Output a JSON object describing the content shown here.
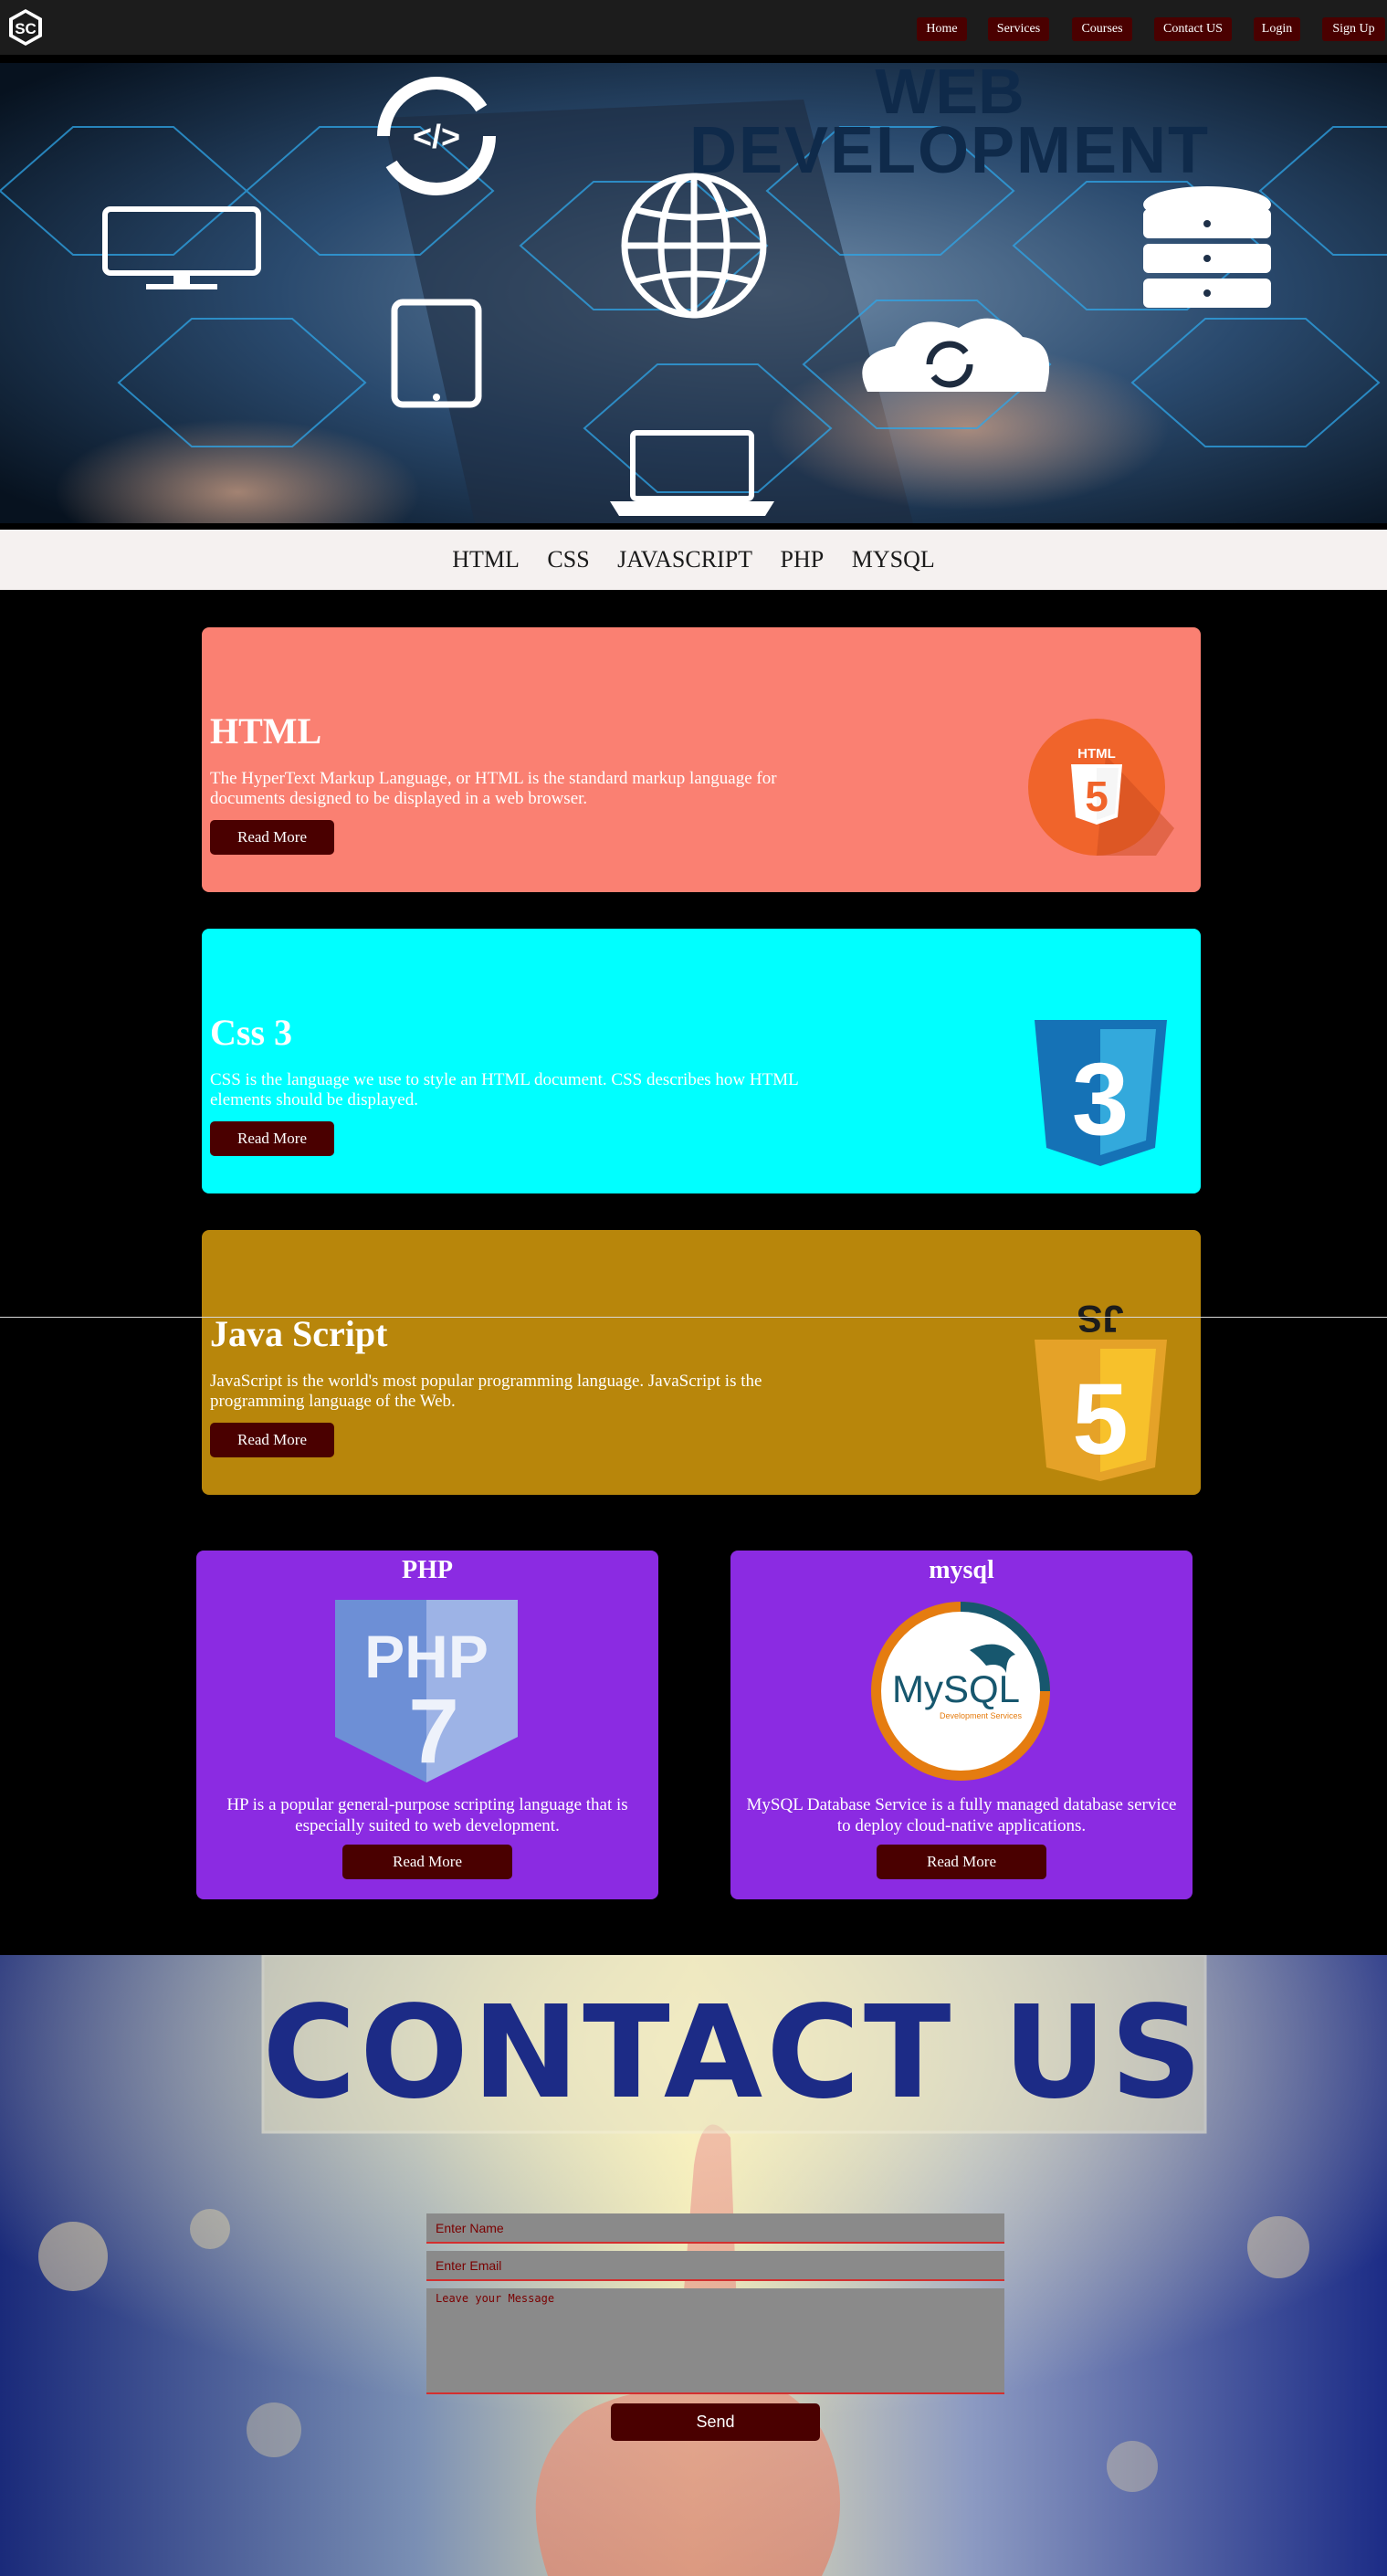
{
  "nav": {
    "logo_text": "SC",
    "items": [
      "Home",
      "Services",
      "Courses",
      "Contact US",
      "Login",
      "Sign Up"
    ]
  },
  "hero": {
    "title_line1": "WEB",
    "title_line2": "DEVELOPMENT",
    "code_glyph": "</>"
  },
  "tech_links": [
    "HTML",
    "CSS",
    "JAVASCRIPT",
    "PHP",
    "MYSQL"
  ],
  "cards": [
    {
      "title": "HTML",
      "description": "The HyperText Markup Language, or HTML is the standard markup language for documents designed to be displayed in a web browser.",
      "button": "Read More",
      "bg": "#fa8072",
      "icon": "html5-logo-icon",
      "logo_label": "HTML",
      "logo_number": "5"
    },
    {
      "title": "Css 3",
      "description": "CSS is the language we use to style an HTML document. CSS describes how HTML elements should be displayed.",
      "button": "Read More",
      "bg": "#00ffff",
      "icon": "css3-logo-icon",
      "logo_number": "3"
    },
    {
      "title": "Java Script",
      "description": "JavaScript is the world's most popular programming language. JavaScript is the programming language of the Web.",
      "button": "Read More",
      "bg": "#b8860b",
      "icon": "javascript-logo-icon",
      "logo_label": "JS",
      "logo_number": "5"
    }
  ],
  "small_cards": [
    {
      "title": "PHP",
      "description": "HP is a popular general-purpose scripting language that is especially suited to web development.",
      "button": "Read More",
      "icon": "php7-logo-icon",
      "logo_text": "PHP",
      "logo_number": "7"
    },
    {
      "title": "mysql",
      "description": "MySQL Database Service is a fully managed database service to deploy cloud-native applications.",
      "button": "Read More",
      "icon": "mysql-logo-icon",
      "logo_text": "MySQL",
      "logo_subtitle": "Development Services"
    }
  ],
  "contact": {
    "banner": "CONTACT US",
    "name_placeholder": "Enter Name",
    "email_placeholder": "Enter Email",
    "message_placeholder": "Leave your Message",
    "send_label": "Send"
  },
  "colors": {
    "nav_bg": "#1c1c1c",
    "button_bg": "#4a0000",
    "small_card_bg": "#8b2be2",
    "tech_bar_bg": "#f5f1f0"
  }
}
